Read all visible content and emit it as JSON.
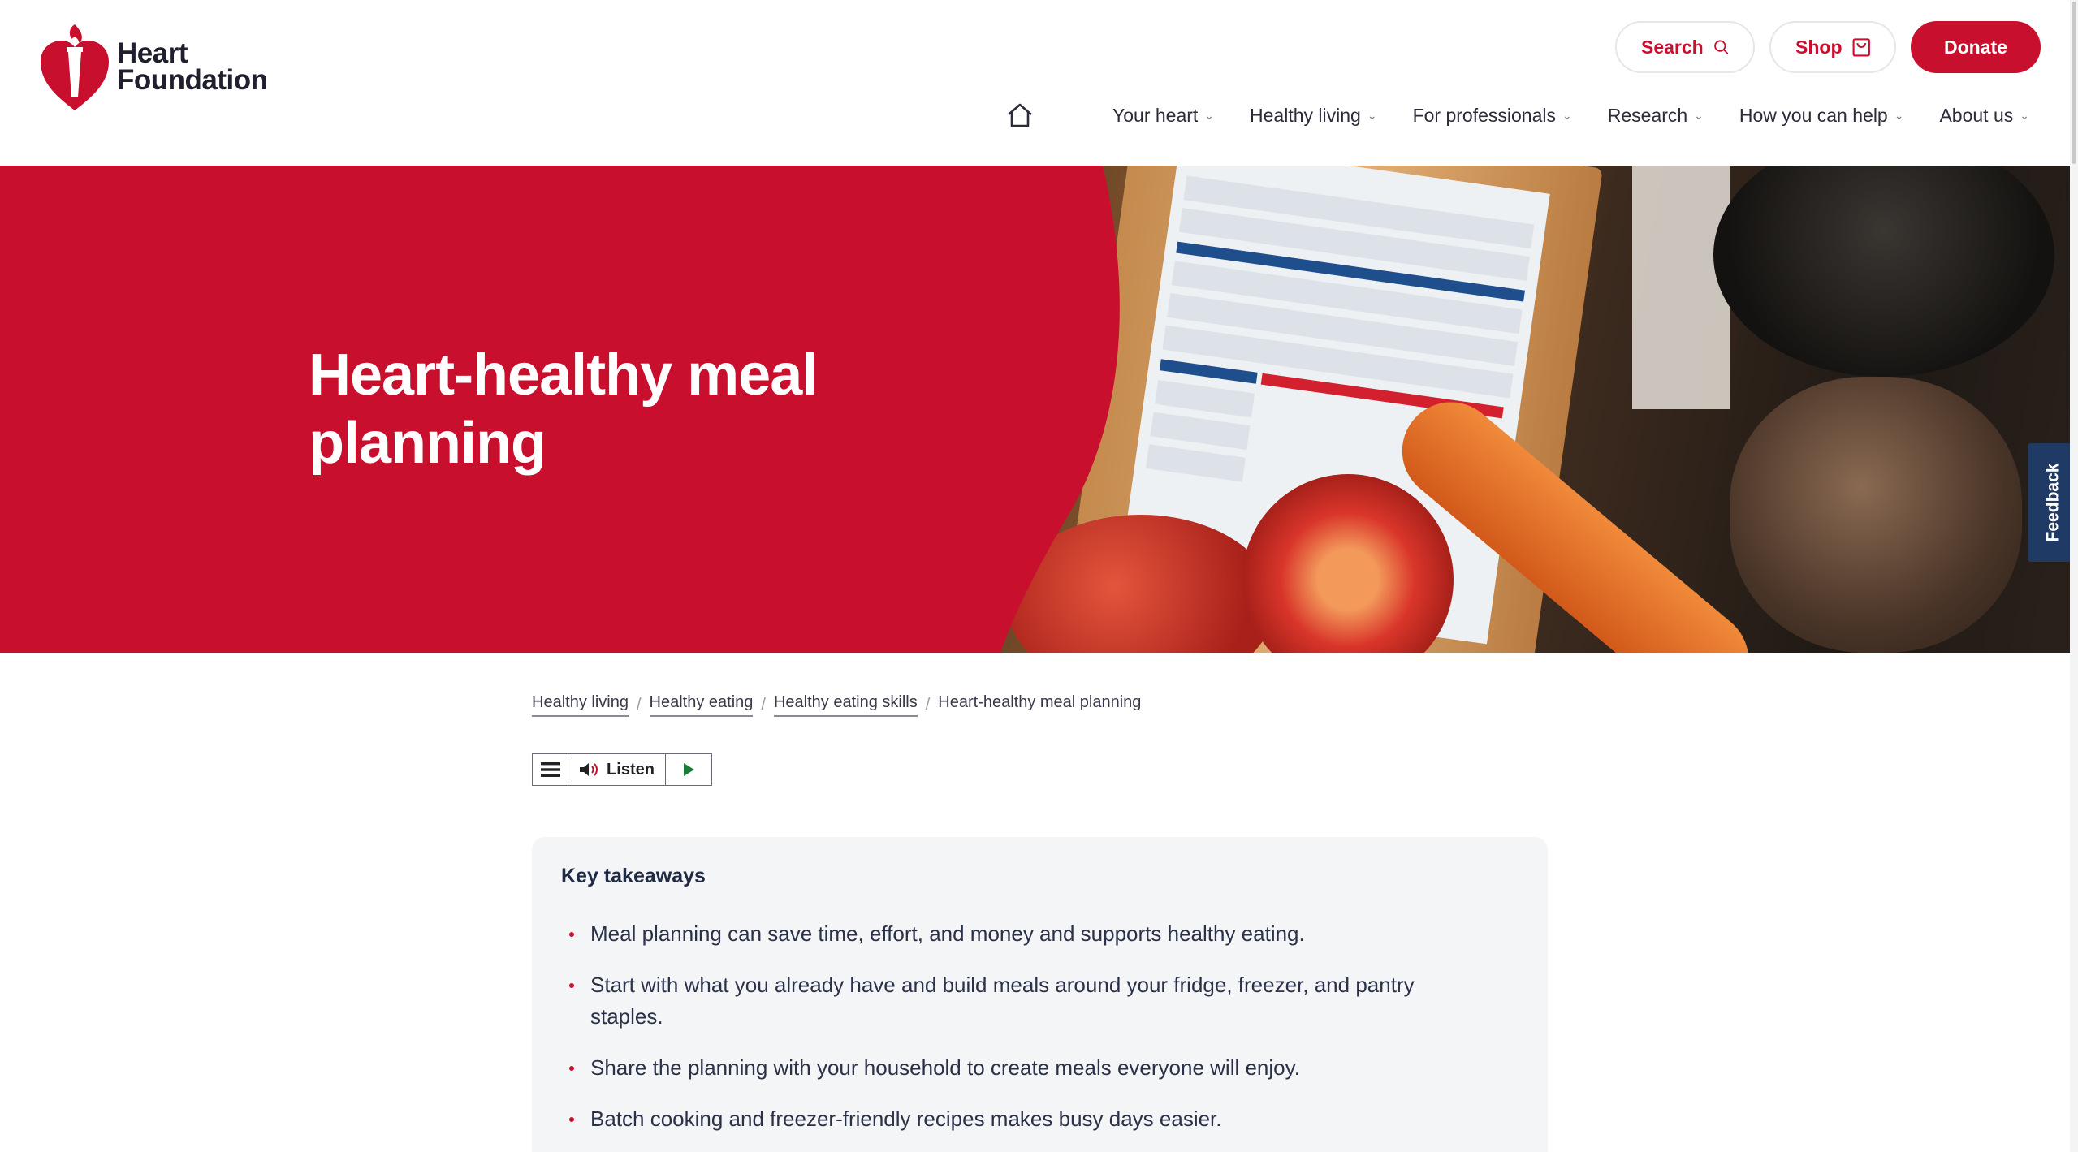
{
  "brand": {
    "logo_line1": "Heart",
    "logo_line2": "Foundation",
    "primary_color": "#c8102e",
    "navy_color": "#203a66"
  },
  "header": {
    "search_label": "Search",
    "shop_label": "Shop",
    "donate_label": "Donate",
    "nav": [
      {
        "label": "Your heart",
        "icon": "chevron-down-icon"
      },
      {
        "label": "Healthy living",
        "icon": "chevron-down-icon"
      },
      {
        "label": "For professionals",
        "icon": "chevron-down-icon"
      },
      {
        "label": "Research",
        "icon": "chevron-down-icon"
      },
      {
        "label": "How you can help",
        "icon": "chevron-down-icon"
      },
      {
        "label": "About us",
        "icon": "chevron-down-icon"
      }
    ]
  },
  "hero": {
    "title_line1": "Heart-healthy meal",
    "title_line2": "planning"
  },
  "feedback": {
    "label": "Feedback"
  },
  "breadcrumb": {
    "items": [
      "Healthy living",
      "Healthy eating",
      "Healthy eating skills"
    ],
    "current": "Heart-healthy meal planning"
  },
  "player": {
    "listen_label": "Listen"
  },
  "takeaways": {
    "title": "Key takeaways",
    "items": [
      "Meal planning can save time, effort, and money and supports healthy eating.",
      "Start with what you already have and build meals around your fridge, freezer, and pantry staples.",
      "Share the planning with your household to create meals everyone will enjoy.",
      "Batch cooking and freezer-friendly recipes makes busy days easier."
    ]
  }
}
